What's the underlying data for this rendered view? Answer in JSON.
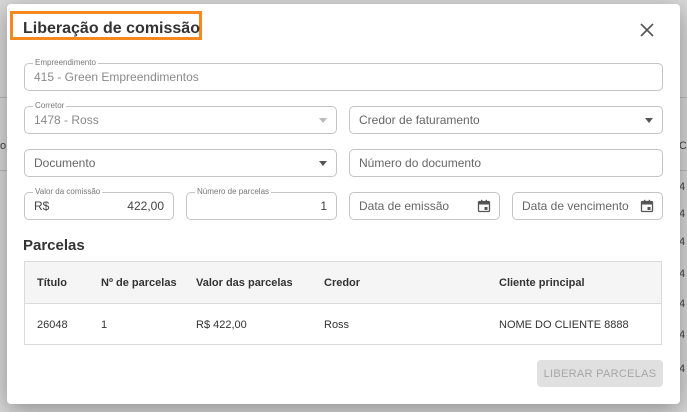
{
  "background": {
    "left_edge_char": "o",
    "right_edge_chars": [
      "C",
      "4",
      "4",
      "4",
      "4",
      "4",
      "4",
      "4"
    ]
  },
  "dialog": {
    "title": "Liberação de comissão",
    "close_icon": "close-icon",
    "fields": {
      "empreendimento": {
        "label": "Empreendimento",
        "value": "415 - Green Empreendimentos"
      },
      "corretor": {
        "label": "Corretor",
        "value": "1478 - Ross"
      },
      "credor_faturamento": {
        "placeholder": "Credor de faturamento"
      },
      "documento": {
        "placeholder": "Documento"
      },
      "numero_documento": {
        "placeholder": "Número do documento"
      },
      "valor_comissao": {
        "label": "Valor da comissão",
        "prefix": "R$",
        "value": "422,00"
      },
      "numero_parcelas": {
        "label": "Número de parcelas",
        "value": "1"
      },
      "data_emissao": {
        "placeholder": "Data de emissão"
      },
      "data_vencimento": {
        "placeholder": "Data de vencimento"
      }
    },
    "parcelas": {
      "title": "Parcelas",
      "columns": [
        "Título",
        "Nº de parcelas",
        "Valor das parcelas",
        "Credor",
        "Cliente principal"
      ],
      "rows": [
        [
          "26048",
          "1",
          "R$ 422,00",
          "Ross",
          "NOME DO CLIENTE 8888"
        ]
      ]
    },
    "liberar_label": "LIBERAR PARCELAS"
  },
  "colors": {
    "highlight": "#f5891f",
    "disabled_button_bg": "#e0e0e0"
  }
}
